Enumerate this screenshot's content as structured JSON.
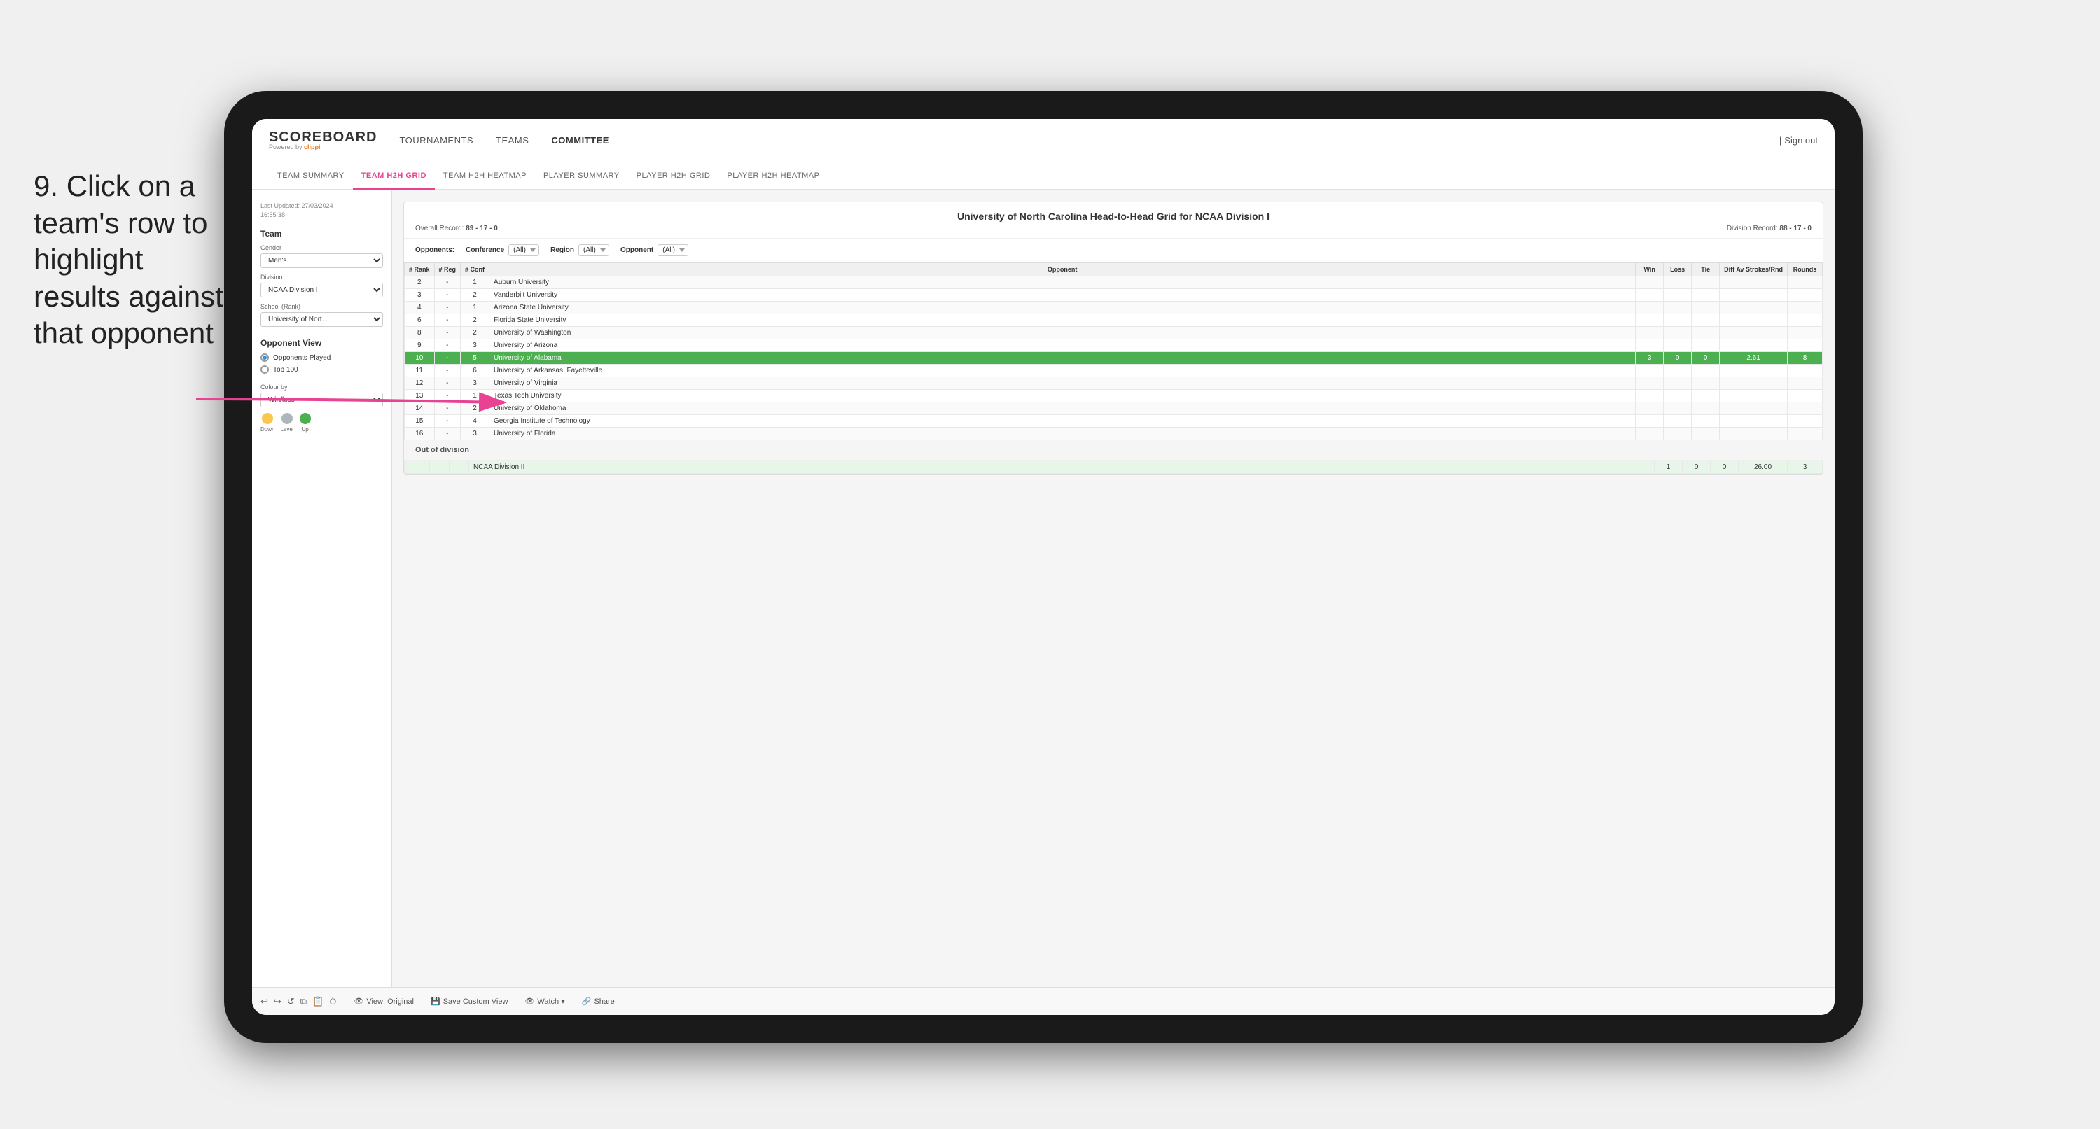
{
  "instruction": {
    "text": "9. Click on a team's row to highlight results against that opponent"
  },
  "nav": {
    "logo": "SCOREBOARD",
    "powered_by": "Powered by",
    "brand": "clippi",
    "items": [
      "TOURNAMENTS",
      "TEAMS",
      "COMMITTEE"
    ],
    "active_item": "COMMITTEE",
    "sign_out_label": "Sign out"
  },
  "sub_nav": {
    "items": [
      "TEAM SUMMARY",
      "TEAM H2H GRID",
      "TEAM H2H HEATMAP",
      "PLAYER SUMMARY",
      "PLAYER H2H GRID",
      "PLAYER H2H HEATMAP"
    ],
    "active_item": "TEAM H2H GRID"
  },
  "sidebar": {
    "timestamp_label": "Last Updated: 27/03/2024",
    "time": "16:55:38",
    "team_label": "Team",
    "gender_label": "Gender",
    "gender_value": "Men's",
    "division_label": "Division",
    "division_value": "NCAA Division I",
    "school_label": "School (Rank)",
    "school_value": "University of Nort...",
    "opponent_view_label": "Opponent View",
    "radio_options": [
      "Opponents Played",
      "Top 100"
    ],
    "radio_selected": "Opponents Played",
    "colour_by_label": "Colour by",
    "colour_by_value": "Win/loss",
    "legend": [
      {
        "label": "Down",
        "color": "#f9c74f"
      },
      {
        "label": "Level",
        "color": "#adb5bd"
      },
      {
        "label": "Up",
        "color": "#4caf50"
      }
    ]
  },
  "panel": {
    "title": "University of North Carolina Head-to-Head Grid for NCAA Division I",
    "overall_record_label": "Overall Record:",
    "overall_record": "89 - 17 - 0",
    "division_record_label": "Division Record:",
    "division_record": "88 - 17 - 0",
    "filters": {
      "opponents_label": "Opponents:",
      "conference_label": "Conference",
      "conference_value": "(All)",
      "region_label": "Region",
      "region_value": "(All)",
      "opponent_label": "Opponent",
      "opponent_value": "(All)"
    },
    "table_headers": [
      "#\nRank",
      "#\nReg",
      "#\nConf",
      "Opponent",
      "Win",
      "Loss",
      "Tie",
      "Diff Av\nStrokes/Rnd",
      "Rounds"
    ],
    "rows": [
      {
        "rank": "2",
        "reg": "-",
        "conf": "1",
        "opponent": "Auburn University",
        "win": "",
        "loss": "",
        "tie": "",
        "diff": "",
        "rounds": "",
        "highlight": false,
        "row_class": ""
      },
      {
        "rank": "3",
        "reg": "-",
        "conf": "2",
        "opponent": "Vanderbilt University",
        "win": "",
        "loss": "",
        "tie": "",
        "diff": "",
        "rounds": "",
        "highlight": false,
        "row_class": ""
      },
      {
        "rank": "4",
        "reg": "-",
        "conf": "1",
        "opponent": "Arizona State University",
        "win": "",
        "loss": "",
        "tie": "",
        "diff": "",
        "rounds": "",
        "highlight": false,
        "row_class": ""
      },
      {
        "rank": "6",
        "reg": "-",
        "conf": "2",
        "opponent": "Florida State University",
        "win": "",
        "loss": "",
        "tie": "",
        "diff": "",
        "rounds": "",
        "highlight": false,
        "row_class": ""
      },
      {
        "rank": "8",
        "reg": "-",
        "conf": "2",
        "opponent": "University of Washington",
        "win": "",
        "loss": "",
        "tie": "",
        "diff": "",
        "rounds": "",
        "highlight": false,
        "row_class": ""
      },
      {
        "rank": "9",
        "reg": "-",
        "conf": "3",
        "opponent": "University of Arizona",
        "win": "",
        "loss": "",
        "tie": "",
        "diff": "",
        "rounds": "",
        "highlight": false,
        "row_class": ""
      },
      {
        "rank": "10",
        "reg": "-",
        "conf": "5",
        "opponent": "University of Alabama",
        "win": "3",
        "loss": "0",
        "tie": "0",
        "diff": "2.61",
        "rounds": "8",
        "highlight": true,
        "row_class": "row-highlighted"
      },
      {
        "rank": "11",
        "reg": "-",
        "conf": "6",
        "opponent": "University of Arkansas, Fayetteville",
        "win": "",
        "loss": "",
        "tie": "",
        "diff": "",
        "rounds": "",
        "highlight": false,
        "row_class": ""
      },
      {
        "rank": "12",
        "reg": "-",
        "conf": "3",
        "opponent": "University of Virginia",
        "win": "",
        "loss": "",
        "tie": "",
        "diff": "",
        "rounds": "",
        "highlight": false,
        "row_class": ""
      },
      {
        "rank": "13",
        "reg": "-",
        "conf": "1",
        "opponent": "Texas Tech University",
        "win": "",
        "loss": "",
        "tie": "",
        "diff": "",
        "rounds": "",
        "highlight": false,
        "row_class": ""
      },
      {
        "rank": "14",
        "reg": "-",
        "conf": "2",
        "opponent": "University of Oklahoma",
        "win": "",
        "loss": "",
        "tie": "",
        "diff": "",
        "rounds": "",
        "highlight": false,
        "row_class": ""
      },
      {
        "rank": "15",
        "reg": "-",
        "conf": "4",
        "opponent": "Georgia Institute of Technology",
        "win": "",
        "loss": "",
        "tie": "",
        "diff": "",
        "rounds": "",
        "highlight": false,
        "row_class": ""
      },
      {
        "rank": "16",
        "reg": "-",
        "conf": "3",
        "opponent": "University of Florida",
        "win": "",
        "loss": "",
        "tie": "",
        "diff": "",
        "rounds": "",
        "highlight": false,
        "row_class": ""
      }
    ],
    "out_of_division_label": "Out of division",
    "out_of_division_row": {
      "label": "NCAA Division II",
      "win": "1",
      "loss": "0",
      "tie": "0",
      "diff": "26.00",
      "rounds": "3"
    }
  },
  "toolbar": {
    "buttons": [
      "View: Original",
      "Save Custom View",
      "Watch ▾",
      "Share"
    ]
  }
}
